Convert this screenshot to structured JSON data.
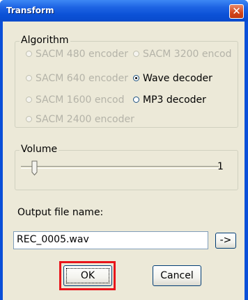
{
  "window": {
    "title": "Transform",
    "close_glyph": "✕"
  },
  "algorithm": {
    "legend": "Algorithm",
    "options": [
      {
        "label": "SACM 480 encoder",
        "selected": false,
        "enabled": false
      },
      {
        "label": "SACM 3200 encod",
        "selected": false,
        "enabled": false
      },
      {
        "label": "SACM 640 encoder",
        "selected": false,
        "enabled": false
      },
      {
        "label": "Wave decoder",
        "selected": true,
        "enabled": true
      },
      {
        "label": "SACM 1600 encod",
        "selected": false,
        "enabled": false
      },
      {
        "label": "MP3 decoder",
        "selected": false,
        "enabled": true
      },
      {
        "label": "SACM 2400 encoder",
        "selected": false,
        "enabled": false
      }
    ]
  },
  "volume": {
    "legend": "Volume",
    "value": "1"
  },
  "output": {
    "label": "Output file name:",
    "value": "REC_0005.wav",
    "browse_label": "->"
  },
  "buttons": {
    "ok": "OK",
    "cancel": "Cancel"
  },
  "colors": {
    "highlight": "#e8141a",
    "title_bar": "#0a4fd8",
    "dialog_bg": "#ece9d8"
  }
}
